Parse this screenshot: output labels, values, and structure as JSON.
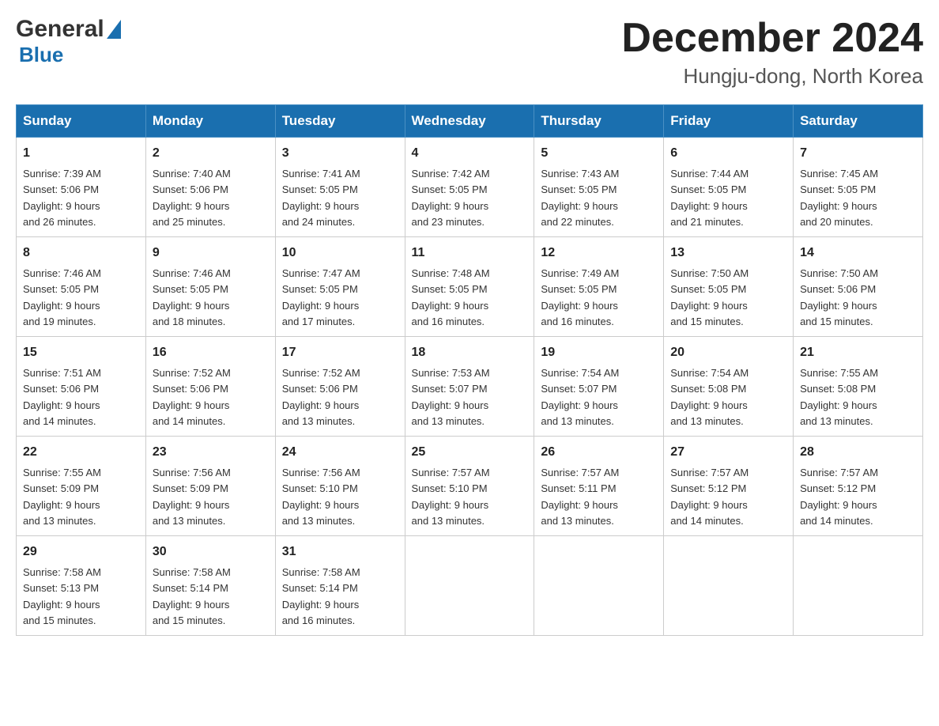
{
  "header": {
    "logo_general": "General",
    "logo_blue": "Blue",
    "title": "December 2024",
    "subtitle": "Hungju-dong, North Korea"
  },
  "days_of_week": [
    "Sunday",
    "Monday",
    "Tuesday",
    "Wednesday",
    "Thursday",
    "Friday",
    "Saturday"
  ],
  "weeks": [
    [
      {
        "day": "1",
        "sunrise": "7:39 AM",
        "sunset": "5:06 PM",
        "daylight": "9 hours and 26 minutes."
      },
      {
        "day": "2",
        "sunrise": "7:40 AM",
        "sunset": "5:06 PM",
        "daylight": "9 hours and 25 minutes."
      },
      {
        "day": "3",
        "sunrise": "7:41 AM",
        "sunset": "5:05 PM",
        "daylight": "9 hours and 24 minutes."
      },
      {
        "day": "4",
        "sunrise": "7:42 AM",
        "sunset": "5:05 PM",
        "daylight": "9 hours and 23 minutes."
      },
      {
        "day": "5",
        "sunrise": "7:43 AM",
        "sunset": "5:05 PM",
        "daylight": "9 hours and 22 minutes."
      },
      {
        "day": "6",
        "sunrise": "7:44 AM",
        "sunset": "5:05 PM",
        "daylight": "9 hours and 21 minutes."
      },
      {
        "day": "7",
        "sunrise": "7:45 AM",
        "sunset": "5:05 PM",
        "daylight": "9 hours and 20 minutes."
      }
    ],
    [
      {
        "day": "8",
        "sunrise": "7:46 AM",
        "sunset": "5:05 PM",
        "daylight": "9 hours and 19 minutes."
      },
      {
        "day": "9",
        "sunrise": "7:46 AM",
        "sunset": "5:05 PM",
        "daylight": "9 hours and 18 minutes."
      },
      {
        "day": "10",
        "sunrise": "7:47 AM",
        "sunset": "5:05 PM",
        "daylight": "9 hours and 17 minutes."
      },
      {
        "day": "11",
        "sunrise": "7:48 AM",
        "sunset": "5:05 PM",
        "daylight": "9 hours and 16 minutes."
      },
      {
        "day": "12",
        "sunrise": "7:49 AM",
        "sunset": "5:05 PM",
        "daylight": "9 hours and 16 minutes."
      },
      {
        "day": "13",
        "sunrise": "7:50 AM",
        "sunset": "5:05 PM",
        "daylight": "9 hours and 15 minutes."
      },
      {
        "day": "14",
        "sunrise": "7:50 AM",
        "sunset": "5:06 PM",
        "daylight": "9 hours and 15 minutes."
      }
    ],
    [
      {
        "day": "15",
        "sunrise": "7:51 AM",
        "sunset": "5:06 PM",
        "daylight": "9 hours and 14 minutes."
      },
      {
        "day": "16",
        "sunrise": "7:52 AM",
        "sunset": "5:06 PM",
        "daylight": "9 hours and 14 minutes."
      },
      {
        "day": "17",
        "sunrise": "7:52 AM",
        "sunset": "5:06 PM",
        "daylight": "9 hours and 13 minutes."
      },
      {
        "day": "18",
        "sunrise": "7:53 AM",
        "sunset": "5:07 PM",
        "daylight": "9 hours and 13 minutes."
      },
      {
        "day": "19",
        "sunrise": "7:54 AM",
        "sunset": "5:07 PM",
        "daylight": "9 hours and 13 minutes."
      },
      {
        "day": "20",
        "sunrise": "7:54 AM",
        "sunset": "5:08 PM",
        "daylight": "9 hours and 13 minutes."
      },
      {
        "day": "21",
        "sunrise": "7:55 AM",
        "sunset": "5:08 PM",
        "daylight": "9 hours and 13 minutes."
      }
    ],
    [
      {
        "day": "22",
        "sunrise": "7:55 AM",
        "sunset": "5:09 PM",
        "daylight": "9 hours and 13 minutes."
      },
      {
        "day": "23",
        "sunrise": "7:56 AM",
        "sunset": "5:09 PM",
        "daylight": "9 hours and 13 minutes."
      },
      {
        "day": "24",
        "sunrise": "7:56 AM",
        "sunset": "5:10 PM",
        "daylight": "9 hours and 13 minutes."
      },
      {
        "day": "25",
        "sunrise": "7:57 AM",
        "sunset": "5:10 PM",
        "daylight": "9 hours and 13 minutes."
      },
      {
        "day": "26",
        "sunrise": "7:57 AM",
        "sunset": "5:11 PM",
        "daylight": "9 hours and 13 minutes."
      },
      {
        "day": "27",
        "sunrise": "7:57 AM",
        "sunset": "5:12 PM",
        "daylight": "9 hours and 14 minutes."
      },
      {
        "day": "28",
        "sunrise": "7:57 AM",
        "sunset": "5:12 PM",
        "daylight": "9 hours and 14 minutes."
      }
    ],
    [
      {
        "day": "29",
        "sunrise": "7:58 AM",
        "sunset": "5:13 PM",
        "daylight": "9 hours and 15 minutes."
      },
      {
        "day": "30",
        "sunrise": "7:58 AM",
        "sunset": "5:14 PM",
        "daylight": "9 hours and 15 minutes."
      },
      {
        "day": "31",
        "sunrise": "7:58 AM",
        "sunset": "5:14 PM",
        "daylight": "9 hours and 16 minutes."
      },
      null,
      null,
      null,
      null
    ]
  ],
  "labels": {
    "sunrise": "Sunrise:",
    "sunset": "Sunset:",
    "daylight": "Daylight:"
  }
}
